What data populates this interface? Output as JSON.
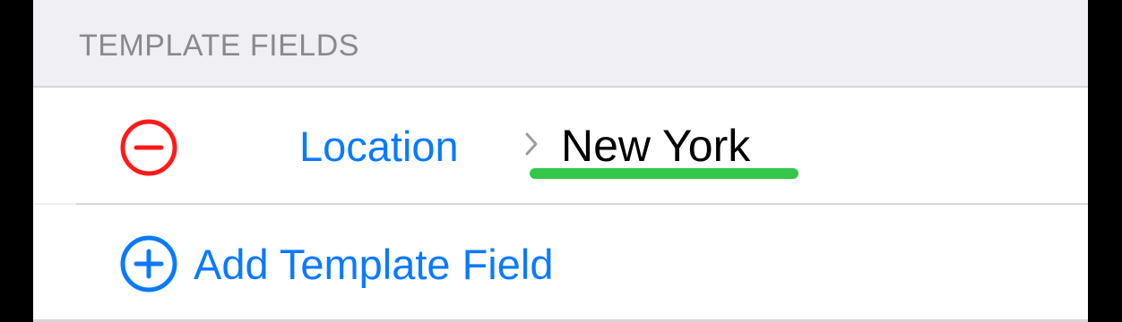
{
  "section": {
    "header": "TEMPLATE FIELDS"
  },
  "fields": [
    {
      "name": "Location",
      "value": "New York"
    }
  ],
  "add_field": {
    "label": "Add Template Field"
  },
  "icons": {
    "remove": "minus-circle-icon",
    "add": "plus-circle-icon",
    "chevron": "chevron-right-icon"
  },
  "colors": {
    "accent": "#0a7aff",
    "destructive": "#ff1a1a",
    "highlight": "#34c74a",
    "header_text": "#8a8a8e",
    "background": "#efeff4"
  }
}
